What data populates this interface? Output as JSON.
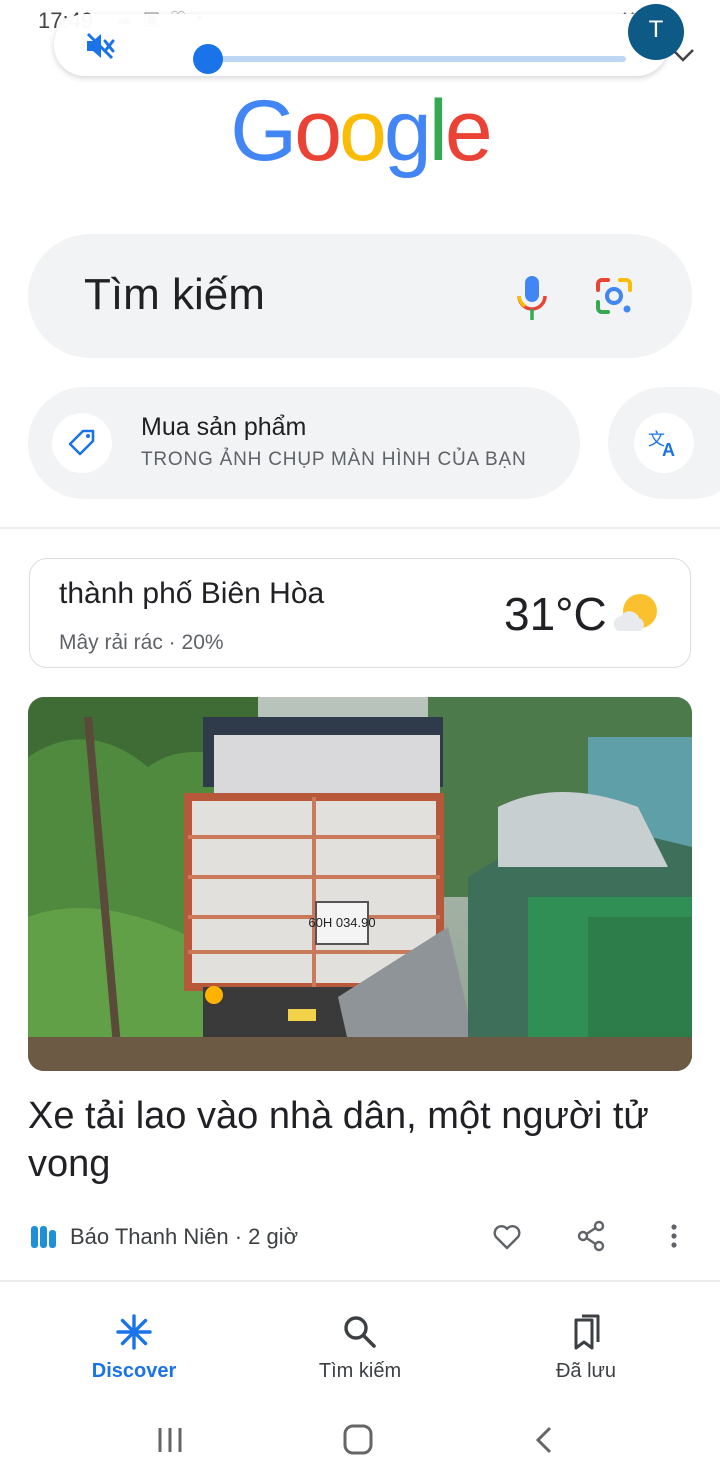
{
  "status_bar": {
    "time": "17:49"
  },
  "volume_panel": {
    "level": 0.0
  },
  "avatar": {
    "initial": "T"
  },
  "google_logo": {
    "letters": [
      "G",
      "o",
      "o",
      "g",
      "l",
      "e"
    ],
    "colors": [
      "#4285F4",
      "#EA4335",
      "#FBBC05",
      "#4285F4",
      "#34A853",
      "#EA4335"
    ]
  },
  "search": {
    "placeholder": "Tìm kiếm"
  },
  "chips": [
    {
      "title": "Mua sản phẩm",
      "subtitle": "TRONG ẢNH CHỤP MÀN HÌNH CỦA BẠN",
      "icon": "tag-icon"
    },
    {
      "title": "",
      "subtitle": "",
      "icon": "translate-icon"
    }
  ],
  "weather": {
    "city": "thành phố Biên Hòa",
    "description": "Mây rải rác · 20%",
    "temperature": "31°C",
    "icon": "partly-cloudy-icon"
  },
  "article": {
    "title": "Xe tải lao vào nhà dân, một người tử vong",
    "source": "Báo Thanh Niên · 2 giờ",
    "plate": "60H 034.90"
  },
  "bottom_nav": [
    {
      "label": "Discover",
      "active": true
    },
    {
      "label": "Tìm kiếm",
      "active": false
    },
    {
      "label": "Đã lưu",
      "active": false
    }
  ],
  "colors": {
    "accent": "#1a73e8",
    "chip_bg": "#f1f3f4"
  }
}
